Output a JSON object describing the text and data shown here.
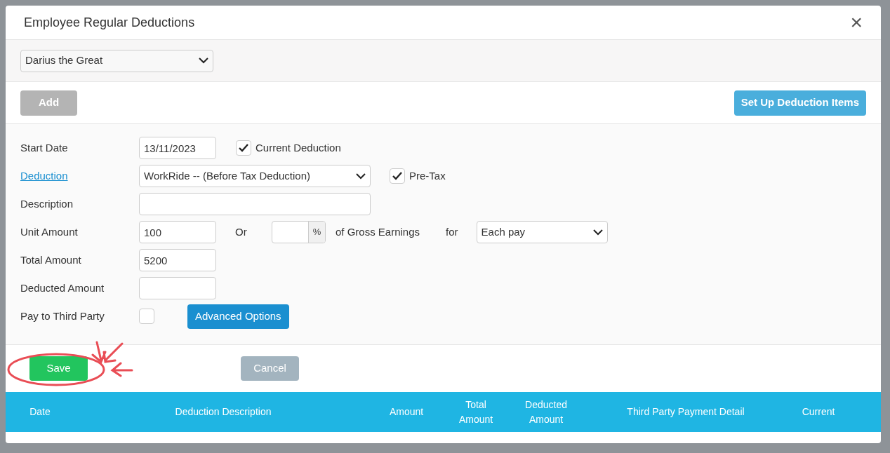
{
  "dialog": {
    "title": "Employee Regular Deductions",
    "close": "×"
  },
  "employee": {
    "value": "Darius the Great"
  },
  "toolbar": {
    "add": {
      "label": "Add",
      "disabled": true
    },
    "setup": {
      "label": "Set Up Deduction Items"
    }
  },
  "form": {
    "start_date": {
      "label": "Start Date",
      "value": "13/11/2023"
    },
    "current_deduction": {
      "label": "Current Deduction",
      "checked": true
    },
    "deduction": {
      "label": "Deduction",
      "value": "WorkRide -- (Before Tax Deduction)"
    },
    "pre_tax": {
      "label": "Pre-Tax",
      "checked": true
    },
    "description": {
      "label": "Description"
    },
    "unit_amount": {
      "label": "Unit Amount",
      "value": "100",
      "or": "Or",
      "percent_symbol": "%",
      "of_gross": "of Gross Earnings",
      "for": "for",
      "frequency": "Each pay"
    },
    "total_amount": {
      "label": "Total Amount",
      "value": "5200"
    },
    "deducted_amount": {
      "label": "Deducted Amount"
    },
    "third_party": {
      "label": "Pay to Third Party",
      "checked": false
    },
    "advanced": "Advanced Options"
  },
  "actions": {
    "save": "Save",
    "cancel": {
      "label": "Cancel",
      "disabled": true
    }
  },
  "table": {
    "columns": [
      "Date",
      "Deduction Description",
      "Amount",
      "Total Amount",
      "Deducted Amount",
      "Third Party Payment Detail",
      "Current"
    ]
  }
}
